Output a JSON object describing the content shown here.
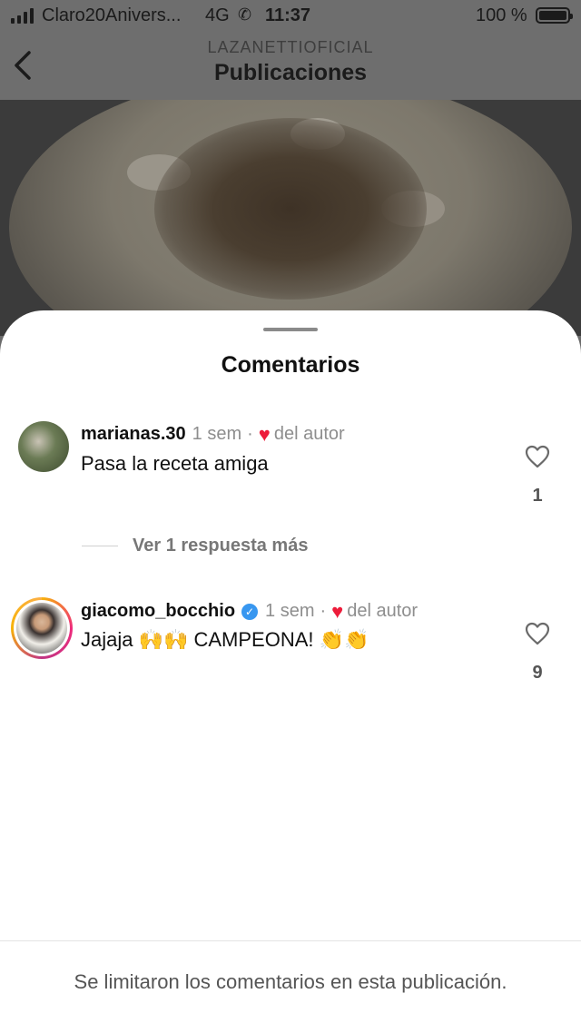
{
  "status_bar": {
    "carrier": "Claro20Anivers...",
    "network": "4G",
    "call_icon": "call-forward-icon",
    "time": "11:37",
    "battery_percent": "100 %",
    "battery_level": 1.0
  },
  "header": {
    "account": "LAZANETTIOFICIAL",
    "title": "Publicaciones",
    "back_icon": "chevron-left-icon"
  },
  "sheet": {
    "title": "Comentarios",
    "comments": [
      {
        "username": "marianas.30",
        "verified": false,
        "time": "1 sem",
        "separator": "·",
        "author_like_label": "del autor",
        "text": "Pasa la receta amiga",
        "like_count": "1"
      },
      {
        "username": "giacomo_bocchio",
        "verified": true,
        "time": "1 sem",
        "separator": "·",
        "author_like_label": "del autor",
        "text": "Jajaja 🙌🙌 CAMPEONA! 👏👏",
        "like_count": "9"
      }
    ],
    "view_replies": "Ver 1 respuesta más",
    "footer_notice": "Se limitaron los comentarios en esta publicación."
  },
  "colors": {
    "verified_blue": "#3897f0",
    "heart_red": "#ed1c3a",
    "dim_overlay": "#6e6e6e"
  }
}
